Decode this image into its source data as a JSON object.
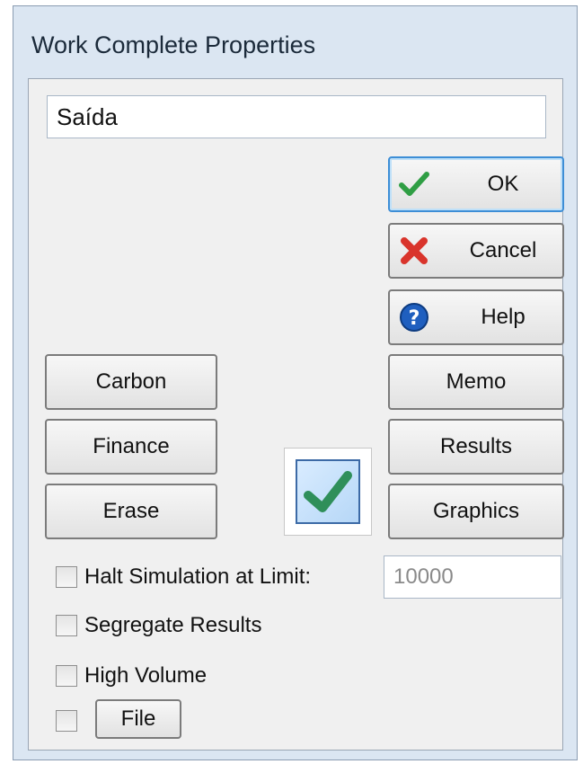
{
  "window": {
    "title": "Work Complete Properties"
  },
  "name_field": {
    "value": "Saída"
  },
  "buttons": {
    "ok": {
      "label": "OK",
      "icon": "check-icon"
    },
    "cancel": {
      "label": "Cancel",
      "icon": "x-icon"
    },
    "help": {
      "label": "Help",
      "icon": "help-icon"
    },
    "carbon": {
      "label": "Carbon"
    },
    "memo": {
      "label": "Memo"
    },
    "finance": {
      "label": "Finance"
    },
    "results": {
      "label": "Results"
    },
    "erase": {
      "label": "Erase"
    },
    "graphics": {
      "label": "Graphics"
    },
    "file": {
      "label": "File"
    }
  },
  "checkboxes": {
    "halt": {
      "label": "Halt Simulation at Limit:",
      "checked": false
    },
    "segregate": {
      "label": "Segregate Results",
      "checked": false
    },
    "high_volume": {
      "label": "High Volume",
      "checked": false
    },
    "file": {
      "checked": false
    }
  },
  "limit_field": {
    "value": "10000"
  },
  "colors": {
    "accent": "#3d8ed6",
    "check_green": "#2f9e44",
    "cancel_red": "#d9342b",
    "help_blue": "#1f5fbf"
  }
}
